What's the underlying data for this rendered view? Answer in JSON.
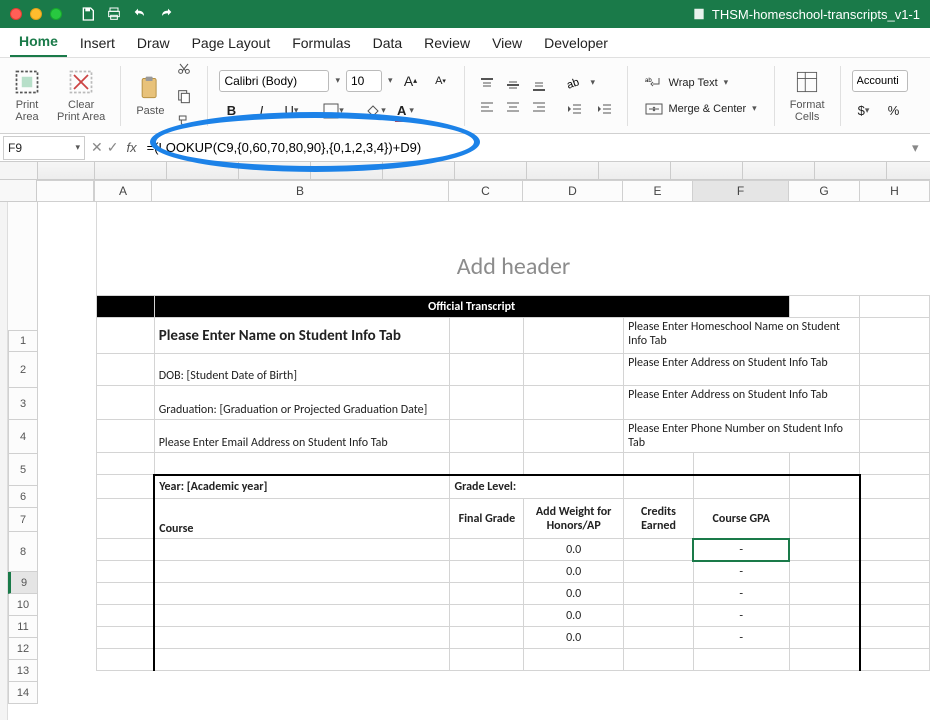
{
  "doc_title": "THSM-homeschool-transcripts_v1-1",
  "tabs": [
    "Home",
    "Insert",
    "Draw",
    "Page Layout",
    "Formulas",
    "Data",
    "Review",
    "View",
    "Developer"
  ],
  "ribbon": {
    "print_area": "Print\nArea",
    "clear_print": "Clear\nPrint Area",
    "paste": "Paste",
    "font_name": "Calibri (Body)",
    "font_size": "10",
    "wrap": "Wrap Text",
    "merge": "Merge & Center",
    "format_cells": "Format\nCells",
    "number_format": "Accounti"
  },
  "namebox": "F9",
  "formula": "=(LOOKUP(C9,{0,60,70,80,90},{0,1,2,3,4})+D9)",
  "col_headers": [
    "A",
    "B",
    "C",
    "D",
    "E",
    "F",
    "G",
    "H"
  ],
  "row_headers": [
    "1",
    "2",
    "3",
    "4",
    "5",
    "6",
    "7",
    "8",
    "9",
    "10",
    "11",
    "12",
    "13",
    "14"
  ],
  "page_header_placeholder": "Add header",
  "content": {
    "title": "Official Transcript",
    "name_prompt": "Please Enter Name on Student Info Tab",
    "homeschool_prompt": "Please Enter Homeschool Name on Student Info Tab",
    "dob": "DOB: [Student Date of Birth]",
    "addr1": "Please Enter Address on Student Info Tab",
    "grad": "Graduation: [Graduation or Projected Graduation Date]",
    "addr2": "Please Enter Address on Student Info Tab",
    "email": "Please Enter Email Address on Student Info Tab",
    "phone": "Please Enter Phone Number on Student Info Tab",
    "year": "Year: [Academic year]",
    "grade_level": "Grade Level:",
    "h_course": "Course",
    "h_final": "Final Grade",
    "h_weight": "Add Weight for Honors/AP",
    "h_credit": "Credits Earned",
    "h_gpa": "Course GPA",
    "zero": "0.0",
    "dash": "-"
  }
}
